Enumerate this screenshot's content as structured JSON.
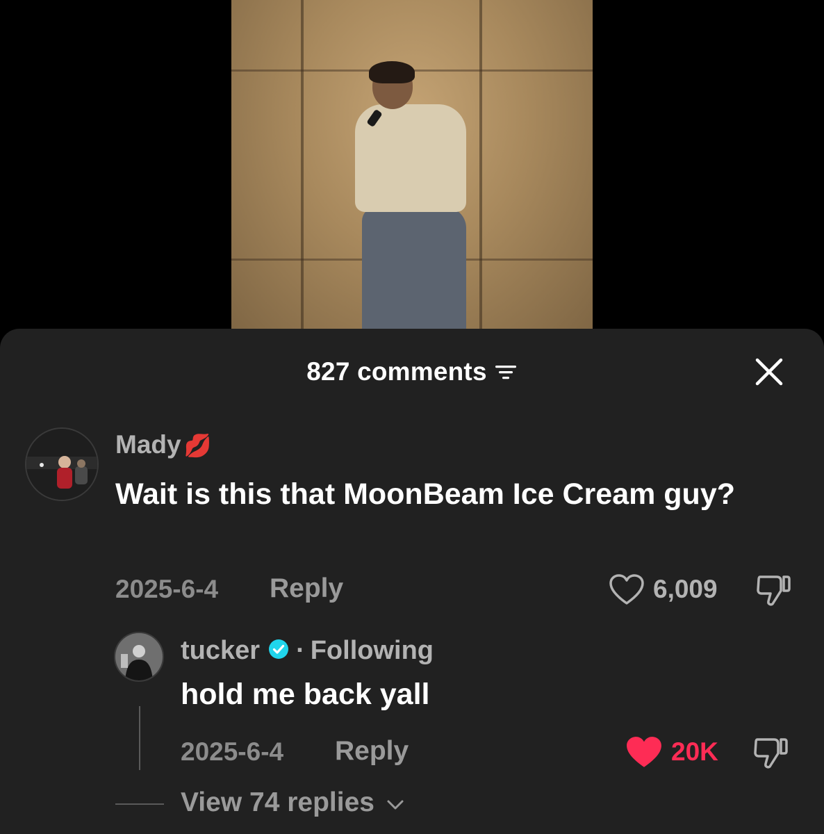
{
  "header": {
    "comment_count": "827 comments"
  },
  "comments": [
    {
      "username": "Mady",
      "emoji": "💋",
      "text": "Wait is this that MoonBeam Ice Cream guy?",
      "date": "2025-6-4",
      "reply_label": "Reply",
      "likes": "6,009",
      "liked": false
    }
  ],
  "replies": [
    {
      "username": "tucker",
      "verified": true,
      "separator": "·",
      "follow_status": "Following",
      "text": "hold me back yall",
      "date": "2025-6-4",
      "reply_label": "Reply",
      "likes": "20K",
      "liked": true
    }
  ],
  "view_replies_label": "View 74 replies",
  "colors": {
    "sheet_bg": "#212121",
    "liked_red": "#fe2c55",
    "verified_blue": "#20d5ec"
  },
  "icons": [
    "sort-icon",
    "close-icon",
    "heart-icon",
    "dislike-icon",
    "verified-icon",
    "chevron-down-icon"
  ]
}
